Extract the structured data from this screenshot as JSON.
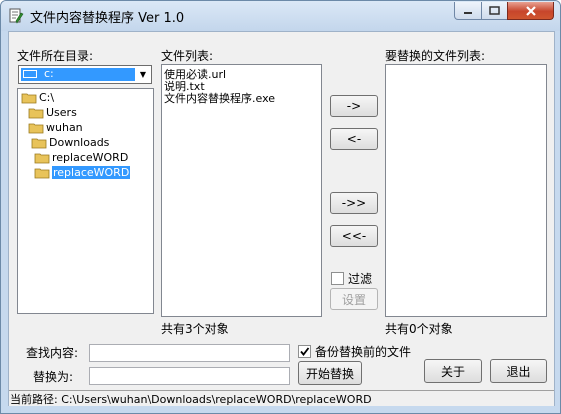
{
  "window": {
    "title": "文件内容替换程序 Ver 1.0",
    "close_color": "#c7452b"
  },
  "left_panel": {
    "dir_label": "文件所在目录:",
    "drive_value": "c:",
    "tree": [
      {
        "label": "C:\\",
        "selected": false
      },
      {
        "label": "Users",
        "selected": false
      },
      {
        "label": "wuhan",
        "selected": false
      },
      {
        "label": "Downloads",
        "selected": false
      },
      {
        "label": "replaceWORD",
        "selected": false
      },
      {
        "label": "replaceWORD",
        "selected": true
      }
    ]
  },
  "file_list": {
    "label": "文件列表:",
    "files": [
      "使用必读.url",
      "说明.txt",
      "文件内容替换程序.exe"
    ],
    "count": "共有3个对象"
  },
  "transfer_buttons": {
    "add": "->",
    "remove": "<-",
    "add_all": "->>",
    "remove_all": "<<-"
  },
  "filter": {
    "checkbox_label": "过滤",
    "checked": false,
    "settings_button": "设置"
  },
  "replace_list": {
    "label": "要替换的文件列表:",
    "files": [],
    "count": "共有0个对象"
  },
  "form": {
    "find_label": "查找内容:",
    "find_value": "",
    "replace_label": "替换为:",
    "replace_value": "",
    "backup_label": "备份替换前的文件",
    "backup_checked": true,
    "start_button": "开始替换",
    "about_button": "关于",
    "exit_button": "退出"
  },
  "status": {
    "text": "当前路径: C:\\Users\\wuhan\\Downloads\\replaceWORD\\replaceWORD"
  }
}
